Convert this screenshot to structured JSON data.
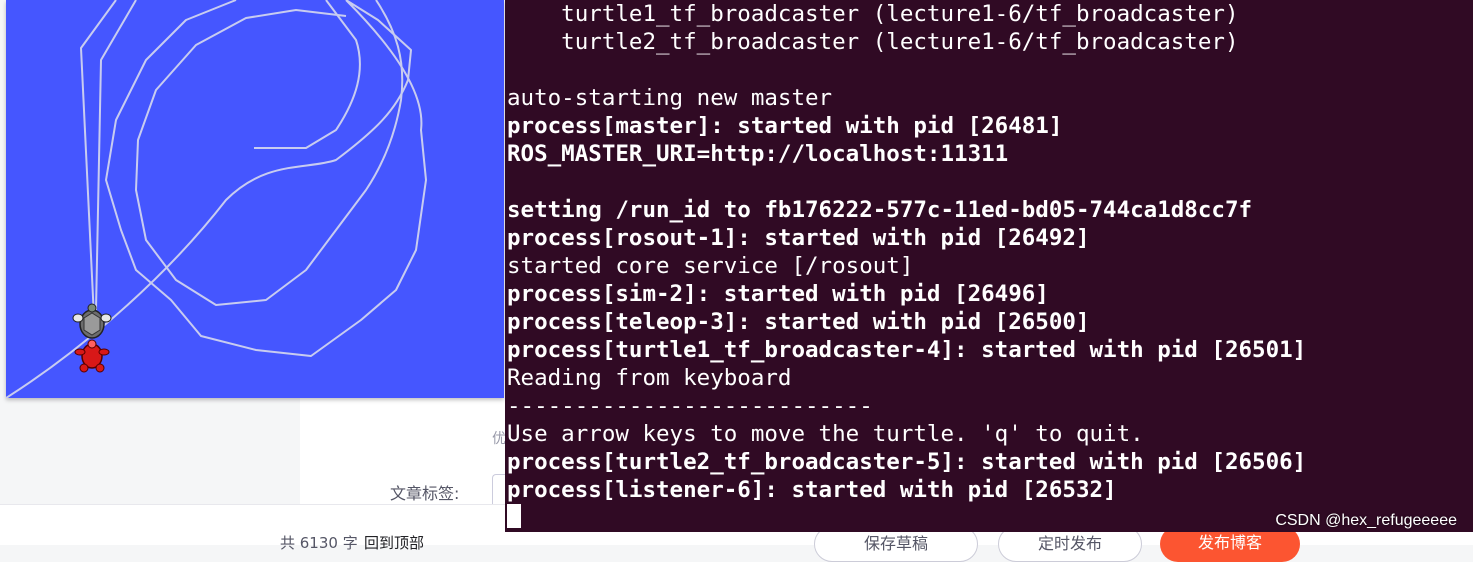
{
  "editor": {
    "tag_label": "文章标签:",
    "cut_char": "优",
    "word_count": "共 6130 字",
    "back_to_top": "回到顶部",
    "buttons": {
      "save_draft": "保存草稿",
      "schedule": "定时发布",
      "publish": "发布博客"
    }
  },
  "terminal": {
    "lines": [
      {
        "text": "    turtle1_tf_broadcaster (lecture1-6/tf_broadcaster)",
        "bold": false
      },
      {
        "text": "    turtle2_tf_broadcaster (lecture1-6/tf_broadcaster)",
        "bold": false
      },
      {
        "text": "",
        "bold": false
      },
      {
        "text": "auto-starting new master",
        "bold": false
      },
      {
        "text": "process[master]: started with pid [26481]",
        "bold": true
      },
      {
        "text": "ROS_MASTER_URI=http://localhost:11311",
        "bold": true
      },
      {
        "text": "",
        "bold": false
      },
      {
        "text": "setting /run_id to fb176222-577c-11ed-bd05-744ca1d8cc7f",
        "bold": true
      },
      {
        "text": "process[rosout-1]: started with pid [26492]",
        "bold": true
      },
      {
        "text": "started core service [/rosout]",
        "bold": false
      },
      {
        "text": "process[sim-2]: started with pid [26496]",
        "bold": true
      },
      {
        "text": "process[teleop-3]: started with pid [26500]",
        "bold": true
      },
      {
        "text": "process[turtle1_tf_broadcaster-4]: started with pid [26501]",
        "bold": true
      },
      {
        "text": "Reading from keyboard",
        "bold": false
      },
      {
        "text": "---------------------------",
        "bold": false
      },
      {
        "text": "Use arrow keys to move the turtle. 'q' to quit.",
        "bold": false
      },
      {
        "text": "process[turtle2_tf_broadcaster-5]: started with pid [26506]",
        "bold": true
      },
      {
        "text": "process[listener-6]: started with pid [26532]",
        "bold": true
      }
    ]
  },
  "watermark": "CSDN @hex_refugeeeee",
  "colors": {
    "turtlesim_bg": "#4556ff",
    "terminal_bg": "#300a24",
    "trail": "#c8ccf0",
    "publish_button": "#fc5531"
  },
  "icons": {
    "turtle_top": "turtle-icon",
    "turtle_bottom": "turtle-icon"
  }
}
